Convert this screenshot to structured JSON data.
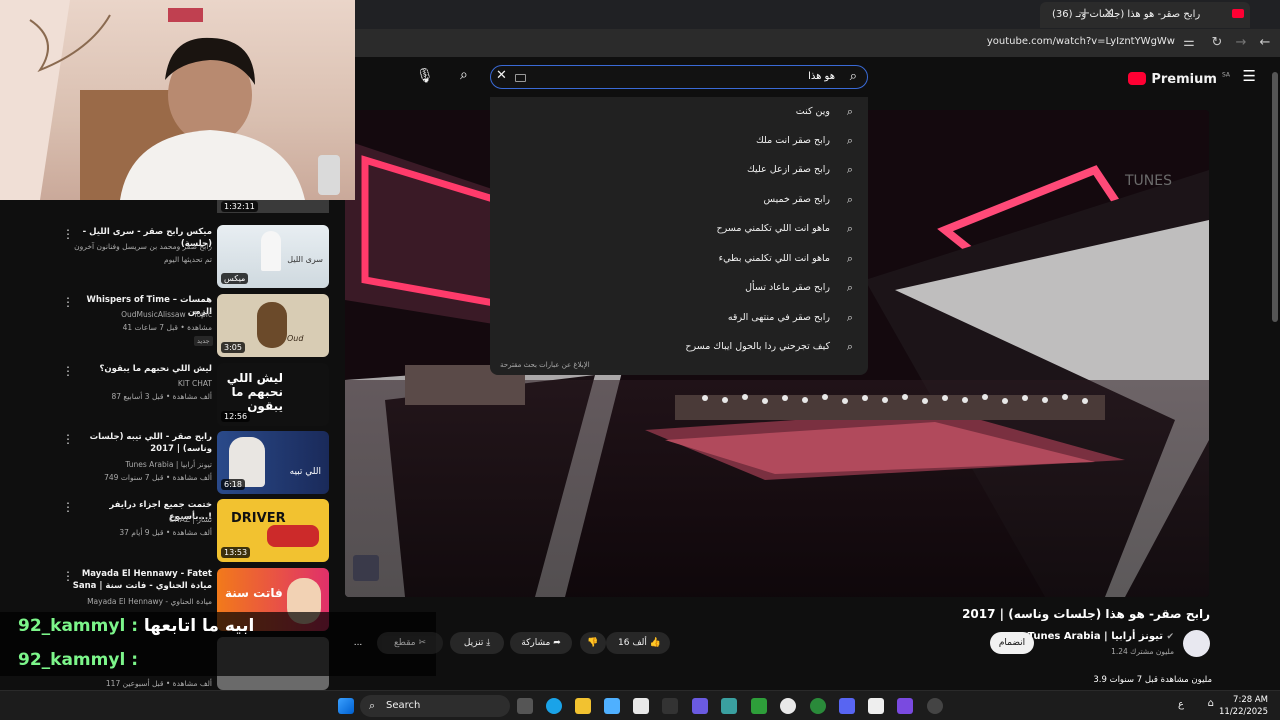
{
  "browser": {
    "tab_title": "(36) رابح صقر- هو هذا (جلسات ونـ",
    "new_tab_label": "+",
    "url": "youtube.com/watch?v=LyIzntYWgWw"
  },
  "header": {
    "brand": "Premium",
    "region": "SA",
    "search_value": "هو هذا"
  },
  "suggestions": [
    "وين كنت",
    "رابح صقر انت ملك",
    "رابح صقر ازعل عليك",
    "رابح صقر خميس",
    "ماهو انت اللي تكلمني مسرح",
    "ماهو انت اللي تكلمني بطيء",
    "رابح صقر ماعاد تسأل",
    "رابح صقر في منتهى الرقه",
    "كيف تجرحني ردا بالحول ايباك مسرح"
  ],
  "report_text": "الإبلاغ عن عبارات بحث مقترحة",
  "sidebar": {
    "top_duration": "1:32:11",
    "items": [
      {
        "title": "ميكس رابح صقر - سرى الليل - (جلسة)",
        "channel": "رابح صقر ومحمد بن سريسل وفنانون آخرون",
        "meta": "تم تحديثها اليوم",
        "duration": "ميكس",
        "thumb_text": "سرى الليل"
      },
      {
        "title": "Whispers of Time – همسات الزمن",
        "channel": "OudMusicAlissaw - Topic",
        "meta": "41 مشاهدة • قبل 7 ساعات",
        "badge": "جديد",
        "duration": "3:05",
        "thumb_text": "Oud"
      },
      {
        "title": "ليش اللي نحبهم ما يبقون؟",
        "channel": "KIT CHAT",
        "meta": "87 ألف مشاهدة • قبل 3 أسابيع",
        "duration": "12:56",
        "thumb_text": "ليش اللي نحبهم ما يبقون"
      },
      {
        "title": "رابح صقر - اللي تيبه (جلسات وناسه) | 2017",
        "channel": "Tunes Arabia | تيونز أرابيا",
        "meta": "749 ألف مشاهدة • قبل 7 سنوات",
        "duration": "6:18",
        "thumb_text": "اللي تبيه"
      },
      {
        "title": "ختمت جميع اجزاء درايفر بأسبوع...!",
        "channel": "CHAZ | تشاز",
        "meta": "37 ألف مشاهدة • قبل 9 أيام",
        "duration": "13:53",
        "thumb_text": "DRIVER"
      },
      {
        "title": "Mayada El Hennawy - Fatet Sana | ميادة الحناوي - فاتت سنة",
        "channel": "Mayada El Hennawy - ميادة الحناوي",
        "meta": "",
        "duration": "",
        "thumb_text": "فاتت سنة"
      },
      {
        "title": "",
        "channel": "",
        "meta": "117 ألف مشاهدة • قبل أسبوعين",
        "duration": "",
        "thumb_text": ""
      }
    ]
  },
  "chat": [
    {
      "user": "92_kammyl",
      "message": "ابيه ما اتابعها"
    },
    {
      "user": "92_kammyl",
      "message": ""
    }
  ],
  "video": {
    "title": "رابح صقر- هو هذا (جلسات وناسه) | 2017",
    "channel": "Tunes Arabia | تيونز أرابيا",
    "subscribers": "1.24 مليون مشترك",
    "join_label": "انضمام",
    "likes": "16 ألف",
    "share_label": "مشاركة",
    "download_label": "تنزيل",
    "clip_label": "مقطع",
    "more_label": "...",
    "views": "3.9 مليون مشاهدة قبل 7 سنوات",
    "watermark": "TUNES"
  },
  "taskbar": {
    "search_label": "Search",
    "time": "7:28 AM",
    "date": "11/22/2025",
    "lang": "ع"
  },
  "colors": {
    "accent": "#ff0033",
    "chat_name": "#7cf58a",
    "focus": "#3a6ad6"
  }
}
